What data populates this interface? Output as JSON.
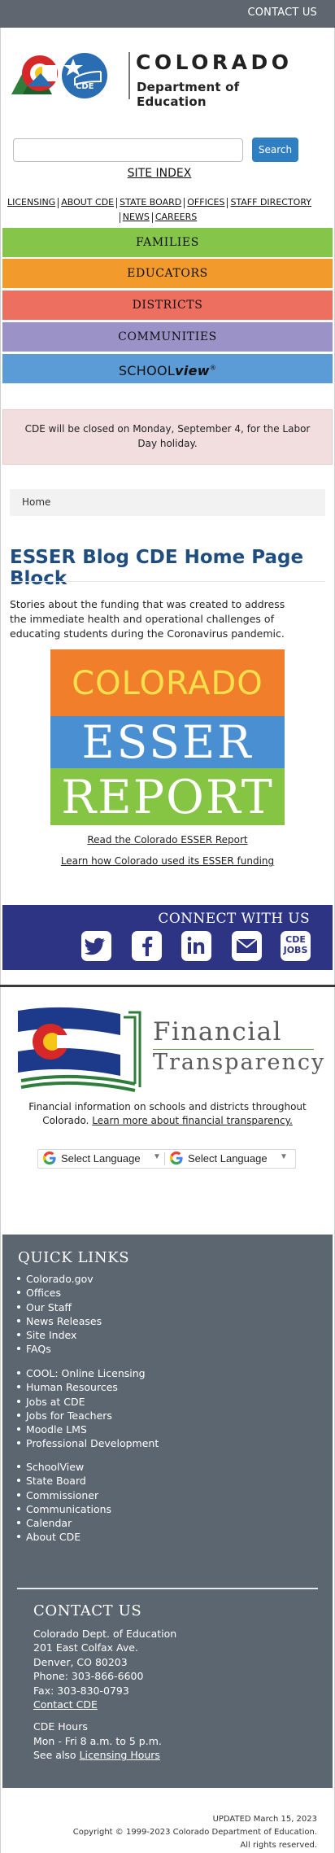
{
  "topbar": {
    "contact_label": "CONTACT US"
  },
  "logo": {
    "wordmark_line1": "COLORADO",
    "wordmark_line2": "Department of Education",
    "badge_text": "CDE"
  },
  "search": {
    "placeholder": "",
    "button_label": "Search"
  },
  "site_index_label": "SITE INDEX",
  "utility_links": {
    "row1": [
      "LICENSING",
      "ABOUT CDE",
      "STATE BOARD",
      "OFFICES",
      "STAFF DIRECTORY"
    ],
    "row2": [
      "NEWS",
      "CAREERS"
    ]
  },
  "nav": {
    "families": "FAMILIES",
    "educators": "EDUCATORS",
    "districts": "DISTRICTS",
    "communities": "COMMUNITIES",
    "schoolview_part1": "SCHOOL",
    "schoolview_part2": "view",
    "schoolview_mark": "®"
  },
  "alert_text": "CDE will be closed on Monday, September 4, for the Labor Day holiday.",
  "breadcrumb": {
    "home": "Home"
  },
  "page_title": "ESSER Blog CDE Home Page Block",
  "intro_text": "Stories about the funding that was created to address the immediate health and operational challenges of educating students during the Coronavirus pandemic.",
  "esser_image": {
    "line1": "COLORADO",
    "line2": "ESSER",
    "line3": "REPORT"
  },
  "links": {
    "read_report": "Read the Colorado ESSER Report",
    "learn_how": "Learn how Colorado used its ESSER funding"
  },
  "connect": {
    "title": "CONNECT WITH US",
    "jobs_line1": "CDE",
    "jobs_line2": "JOBS"
  },
  "financial": {
    "title_line1": "Financial",
    "title_line2": "Transparency",
    "text": "Financial information on schools and districts throughout Colorado.",
    "link": "Learn more about financial transparency."
  },
  "translate": {
    "label1": "Select Language",
    "label2": "Select Language",
    "arrow": "▼"
  },
  "footer": {
    "quick_links_title": "QUICK LINKS",
    "group1": [
      "Colorado.gov",
      "Offices",
      "Our Staff",
      "News Releases",
      "Site Index",
      "FAQs"
    ],
    "group2": [
      "COOL: Online Licensing",
      "Human Resources",
      "Jobs at CDE",
      "Jobs for Teachers",
      "Moodle LMS",
      "Professional Development"
    ],
    "group3": [
      "SchoolView",
      "State Board",
      "Commissioner",
      "Communications",
      "Calendar",
      "About CDE"
    ],
    "contact_title": "CONTACT US",
    "contact_name": "Colorado Dept. of Education",
    "address1": "201 East Colfax Ave.",
    "address2": "Denver, CO 80203",
    "phone": "Phone: 303-866-6600",
    "fax": "Fax: 303-830-0793",
    "contact_link": "Contact CDE",
    "hours_title": "CDE Hours",
    "hours": "Mon - Fri 8 a.m. to 5 p.m.",
    "see_also": "See also",
    "licensing_hours": "Licensing Hours"
  },
  "bottom": {
    "updated": "UPDATED March 15, 2023",
    "copyright": "Copyright © 1999-2023 Colorado Department of Education.",
    "rights": "All rights reserved."
  },
  "colors": {
    "families": "#84c54a",
    "educators": "#f39a2d",
    "districts": "#ed6f5f",
    "communities": "#9b93c8",
    "schoolview": "#5b9bd6",
    "connect_bg": "#2e3484",
    "footer_bg": "#5c6670",
    "title": "#1f4d80"
  },
  "icons": [
    "twitter-icon",
    "facebook-icon",
    "linkedin-icon",
    "email-icon",
    "cde-jobs-icon",
    "google-icon"
  ]
}
